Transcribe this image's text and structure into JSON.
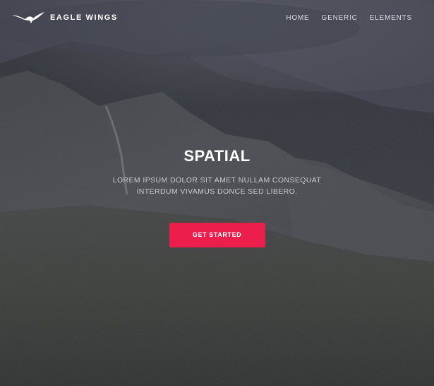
{
  "header": {
    "brand_name": "EAGLE WINGS",
    "logo_icon": "eagle-icon",
    "nav": [
      {
        "label": "HOME"
      },
      {
        "label": "GENERIC"
      },
      {
        "label": "ELEMENTS"
      }
    ]
  },
  "hero": {
    "title": "SPATIAL",
    "subtitle": "LOREM IPSUM DOLOR SIT AMET NULLAM CONSEQUAT INTERDUM VIVAMUS DONCE SED LIBERO.",
    "cta_label": "GET STARTED"
  },
  "colors": {
    "accent": "#ec1f4c",
    "text": "#ffffff",
    "background": "#3a3d45"
  }
}
